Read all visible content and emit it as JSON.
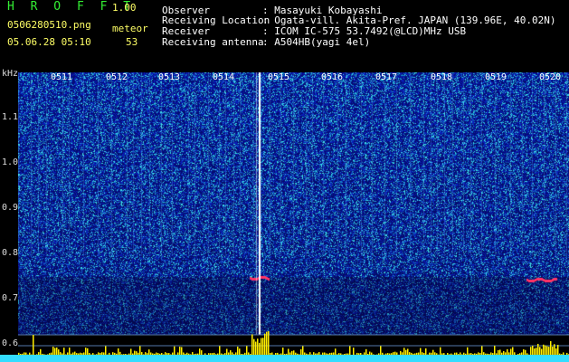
{
  "app": {
    "name": "H R O F F T",
    "version": "1.00"
  },
  "file": {
    "name": "0506280510.png",
    "datetime": "05.06.28 05:10"
  },
  "stat": {
    "label": "meteor",
    "count": "53"
  },
  "info": {
    "observer_label": "Observer",
    "observer_value": ": Masayuki Kobayashi",
    "location_label": "Receiving Location",
    "location_value": ": Ogata-vill. Akita-Pref. JAPAN (139.96E, 40.02N)",
    "receiver_label": "Receiver",
    "receiver_value": ": ICOM IC-575 53.7492(@LCD)MHz USB",
    "antenna_label": "Receiving antenna",
    "antenna_value": ": A504HB(yagi 4el)"
  },
  "axis": {
    "unit": "kHz",
    "ticks": [
      "1.1",
      "1.0",
      "0.9",
      "0.8",
      "0.7",
      "0.6"
    ],
    "time_marks": [
      "0511",
      "0512",
      "0513",
      "0514",
      "0515",
      "0516",
      "0517",
      "0518",
      "0519",
      "0520"
    ]
  },
  "colors": {
    "bg": "#000000",
    "noise_low": "#0a1a8a",
    "noise_high": "#33ddee",
    "echo": "#ff3366",
    "level": "#ffee00",
    "baseline": "#33ddff"
  }
}
